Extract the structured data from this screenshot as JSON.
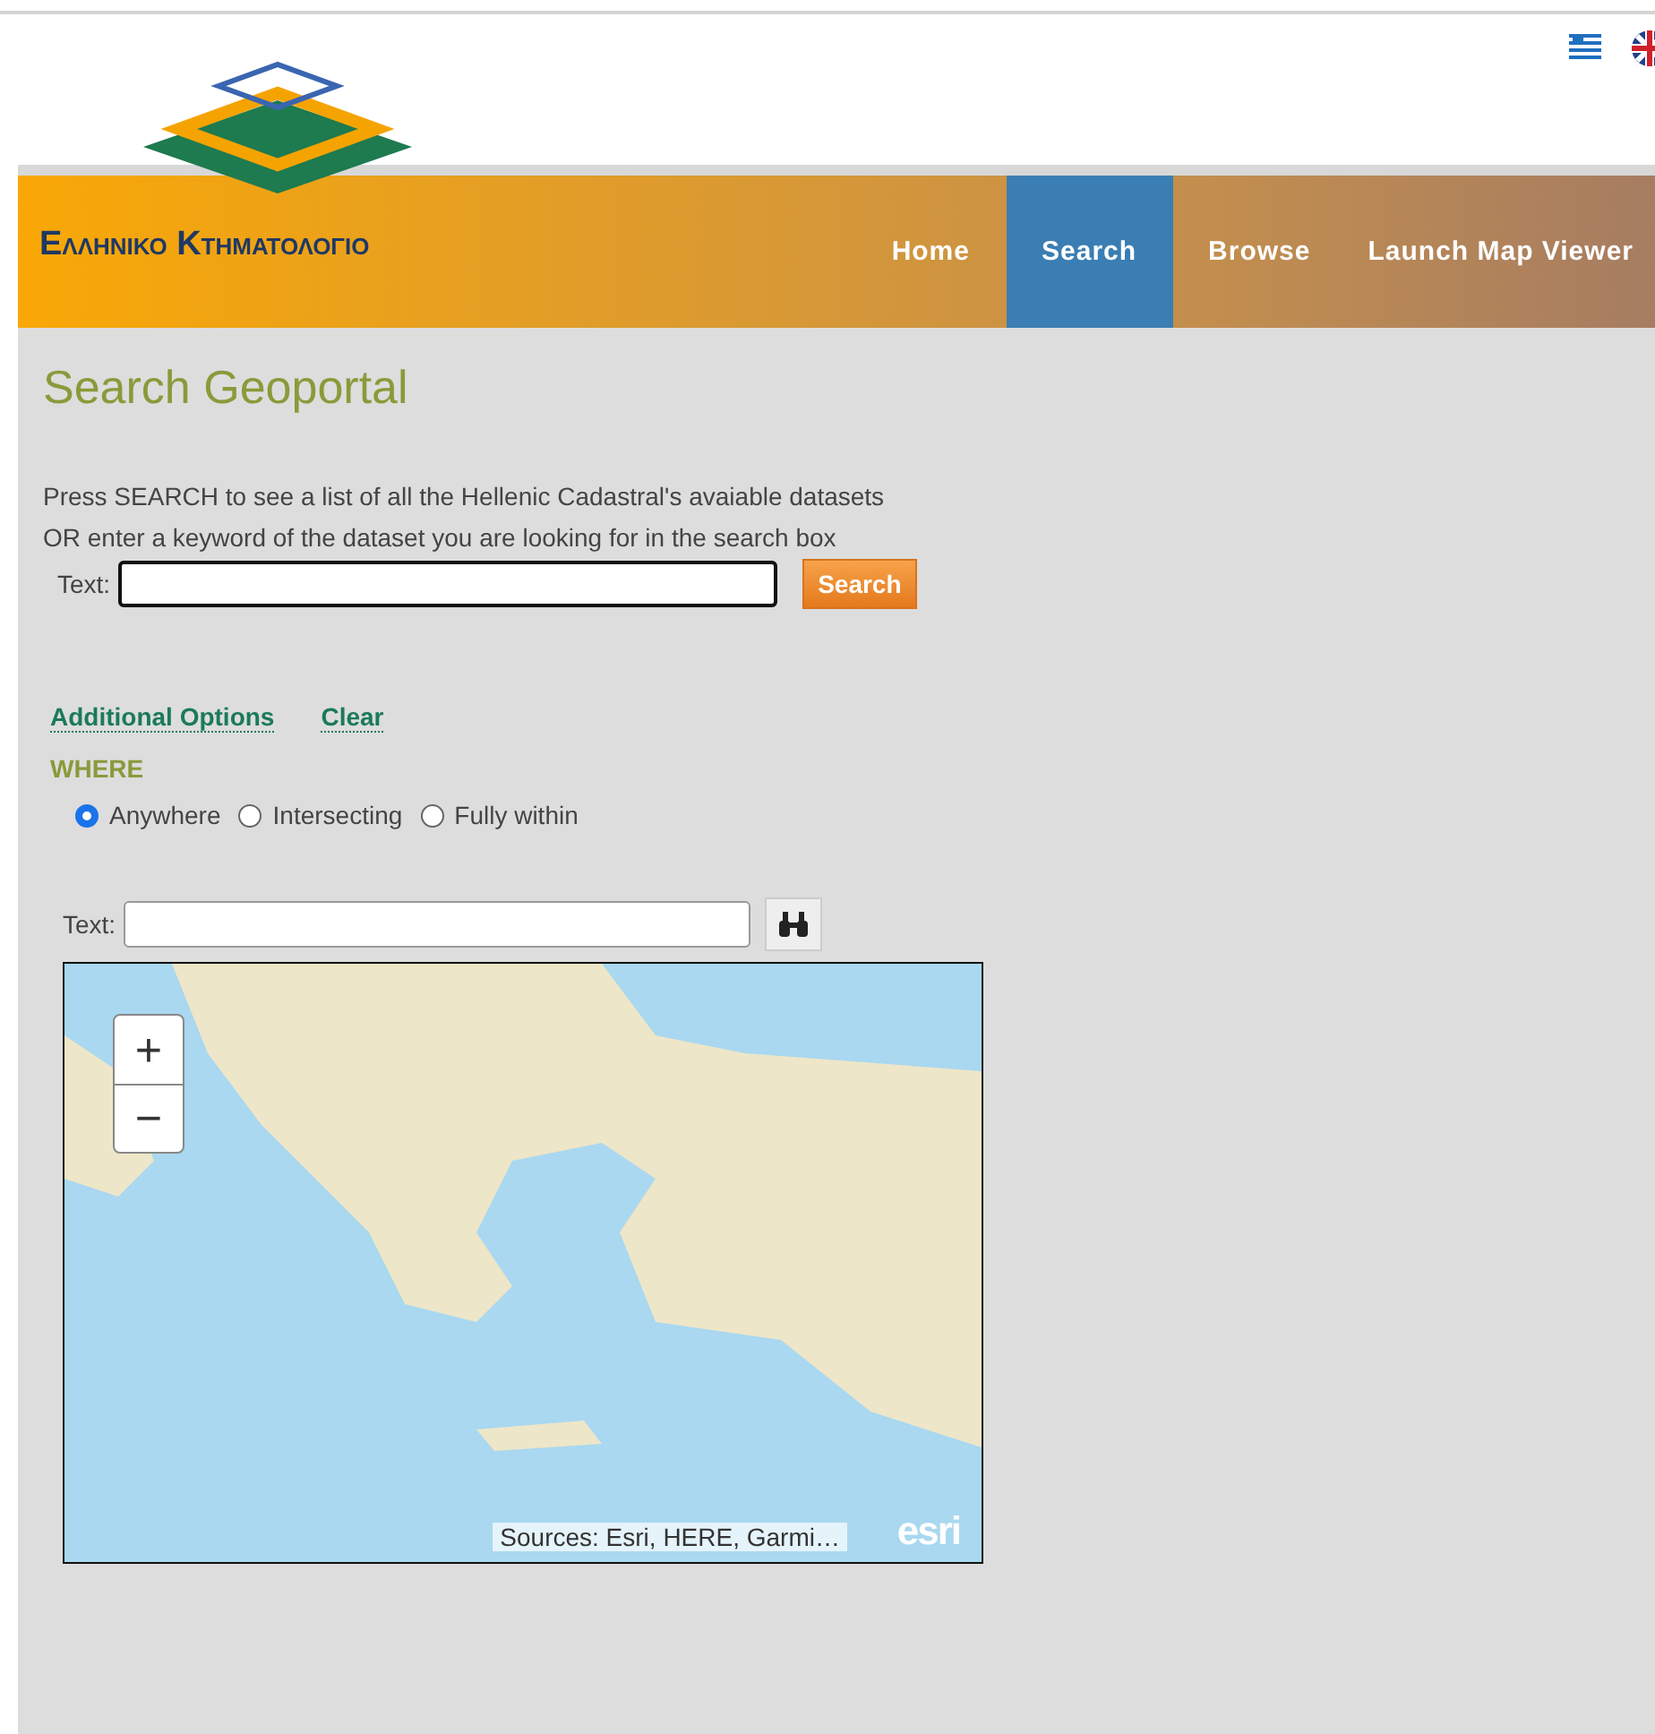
{
  "header": {
    "languages": [
      {
        "kind": "greek",
        "selected": false
      },
      {
        "kind": "english",
        "selected": false
      }
    ]
  },
  "brand": {
    "title": "Ελληνικο Κτηματολογιο"
  },
  "nav": [
    {
      "label": "Home",
      "selected": false
    },
    {
      "label": "Search",
      "selected": true
    },
    {
      "label": "Browse",
      "selected": false
    },
    {
      "label": "Launch Map Viewer",
      "selected": false
    }
  ],
  "page": {
    "title": "Search Geoportal",
    "intro": [
      "Press SEARCH to see a list of all the Hellenic Cadastral's avaiable datasets",
      "OR enter a keyword of the dataset you are looking for in the search box"
    ]
  },
  "search": {
    "label": "Text:",
    "button": "Search"
  },
  "links": [
    "Additional Options",
    "Clear"
  ],
  "where": {
    "heading": "WHERE",
    "options": [
      {
        "label": "Anywhere",
        "selected": true
      },
      {
        "label": "Intersecting",
        "selected": false
      },
      {
        "label": "Fully within",
        "selected": false
      }
    ]
  },
  "map": {
    "search_label": "Text:",
    "zoom_in": "+",
    "zoom_out": "−",
    "attribution": "Sources: Esri, HERE, Garmi…",
    "logo": "esri"
  }
}
